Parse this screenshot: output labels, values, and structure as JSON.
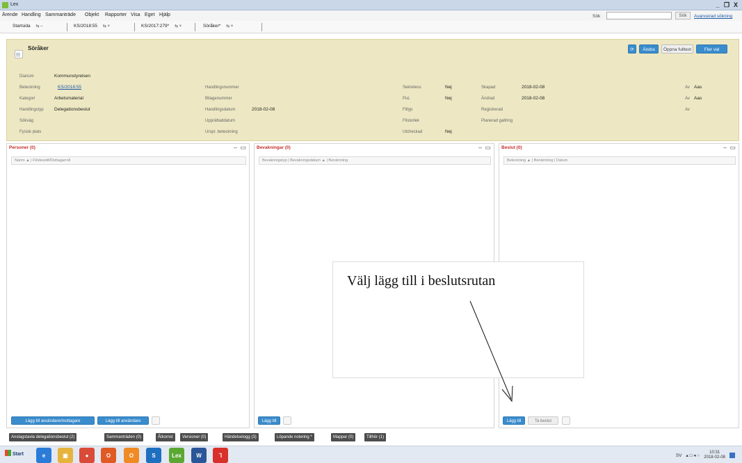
{
  "window": {
    "title": "Lex",
    "controls": [
      "_",
      "ͦ",
      "X"
    ]
  },
  "menu": [
    "Ärende",
    "Handling",
    "Sammanträde",
    "Objekt",
    "Rapporter",
    "Visa",
    "Eget",
    "Hjälp"
  ],
  "search": {
    "label": "Sök",
    "value": "",
    "button": "Sök",
    "advanced": "Avancerad sökning"
  },
  "tabs": [
    {
      "label": "Startsida",
      "controls": "⇆ –"
    },
    {
      "label": "KS/2018:55",
      "controls": "⇆ ×"
    },
    {
      "label": "KS/2017:279*",
      "controls": "⇆ ×"
    },
    {
      "label": "Söråker*",
      "controls": "⇆ ×"
    }
  ],
  "header": {
    "title": "Söråker",
    "buttons": {
      "refresh": "⟳",
      "edit": "Ändra",
      "open_fulltext": "Öppna fulltext",
      "more": "Fler val"
    },
    "fields": {
      "diarium": {
        "label": "Diarium",
        "value": "Kommunstyrelsen"
      },
      "beteckning": {
        "label": "Beteckning",
        "value": "KS/2018:55"
      },
      "kategori": {
        "label": "Kategori",
        "value": "Arbetsmaterial"
      },
      "handlingstyp": {
        "label": "Handlingstyp",
        "value": "Delegationsbeslut"
      },
      "sokvag": {
        "label": "Sökväg",
        "value": ""
      },
      "fysisk_plats": {
        "label": "Fysisk plats",
        "value": ""
      },
      "handlingsnummer": {
        "label": "Handlingsnummer",
        "value": ""
      },
      "bilagenummer": {
        "label": "Bilagenummer",
        "value": ""
      },
      "handlingsdatum": {
        "label": "Handlingsdatum",
        "value": "2018-02-08"
      },
      "upprattaddatum": {
        "label": "Upprättaddatum",
        "value": ""
      },
      "urspr_beteckning": {
        "label": "Urspr. beteckning",
        "value": ""
      },
      "sekretess": {
        "label": "Sekretess",
        "value": "Nej"
      },
      "pul": {
        "label": "PuL",
        "value": "Nej"
      },
      "filtyp": {
        "label": "Filtyp",
        "value": ""
      },
      "filstorlek": {
        "label": "Filstorlek",
        "value": ""
      },
      "utcheckad": {
        "label": "Utcheckad",
        "value": "Nej"
      },
      "skapad": {
        "label": "Skapad",
        "value": "2018-02-08",
        "av_label": "Av",
        "av_value": "Aas"
      },
      "andrad": {
        "label": "Ändrad",
        "value": "2018-02-08",
        "av_label": "Av",
        "av_value": "Aas"
      },
      "registrerad": {
        "label": "Registrerad",
        "value": "",
        "av_label": "Av",
        "av_value": ""
      },
      "planerad_gallring": {
        "label": "Planerad gallring",
        "value": ""
      }
    }
  },
  "panels": {
    "personer": {
      "title": "Personer (0)",
      "columns": "Namn ▲  |  Flödesstill/Deltagarroll",
      "buttons": [
        "Lägg till avsändare/mottagare",
        "Lägg till användare"
      ]
    },
    "bevakningar": {
      "title": "Bevakningar (0)",
      "columns": "Bevakningstyp  |  Bevakningsdatum ▲  |  Benämning",
      "buttons": [
        "Lägg till"
      ]
    },
    "beslut": {
      "title": "Beslut (0)",
      "columns": "Beteckning ▲  |  Benämning  |  Datum",
      "buttons": [
        "Lägg till",
        "Ta beslut"
      ]
    },
    "panel_controls": "– ▭"
  },
  "bottom_tabs": [
    "Anslagstavla delegationsbeslut (2)",
    "Sammanträden (0)",
    "Åtkomst",
    "Versioner (0)",
    "Händelselogg (3)",
    "Löpande notering *",
    "Mappar (0)",
    "Tillhör (1)"
  ],
  "taskbar": {
    "start": "Start",
    "apps": [
      {
        "name": "ie-icon",
        "glyph": "e",
        "color": "#2b7bd8"
      },
      {
        "name": "folder-icon",
        "glyph": "▣",
        "color": "#e6b43c"
      },
      {
        "name": "chrome-icon",
        "glyph": "●",
        "color": "#d94a38"
      },
      {
        "name": "outlook-app-icon",
        "glyph": "O",
        "color": "#e05a24"
      },
      {
        "name": "outlook-icon",
        "glyph": "O",
        "color": "#f08a24"
      },
      {
        "name": "skype-icon",
        "glyph": "S",
        "color": "#1f6fc0"
      },
      {
        "name": "lex-icon",
        "glyph": "Lex",
        "color": "#5aa832"
      },
      {
        "name": "word-icon",
        "glyph": "W",
        "color": "#2a5699"
      },
      {
        "name": "acrobat-icon",
        "glyph": "⅂",
        "color": "#d8302a"
      }
    ],
    "tray": {
      "language": "SV",
      "time": "10:31",
      "date": "2018-02-08"
    }
  },
  "annotation": {
    "text": "Välj lägg till i beslutsrutan"
  }
}
